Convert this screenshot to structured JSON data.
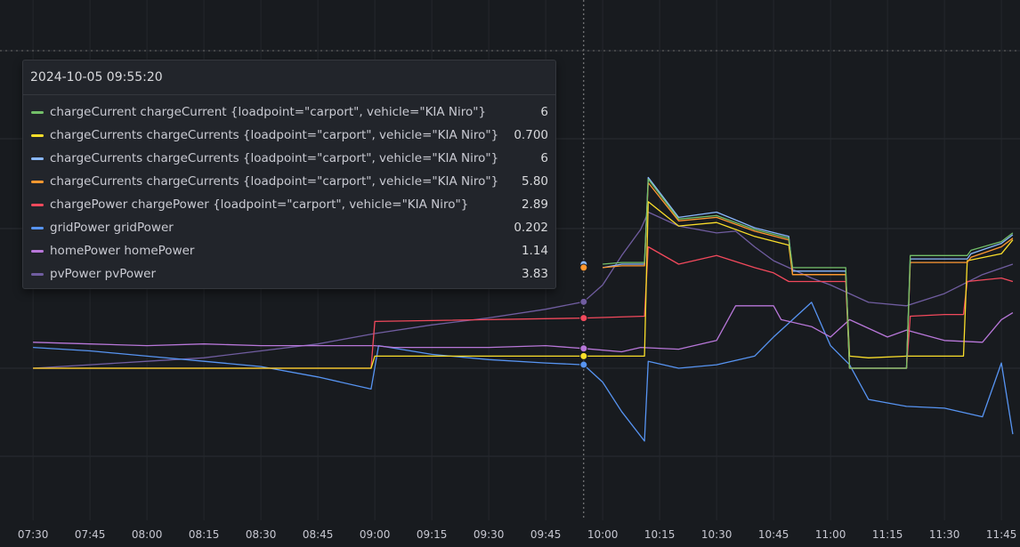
{
  "chart_data": {
    "type": "line",
    "x_range": [
      "07:30",
      "11:48"
    ],
    "x_ticks": [
      "07:30",
      "07:45",
      "08:00",
      "08:15",
      "08:30",
      "08:45",
      "09:00",
      "09:15",
      "09:30",
      "09:45",
      "10:00",
      "10:15",
      "10:30",
      "10:45",
      "11:00",
      "11:15",
      "11:30",
      "11:45"
    ],
    "hover_time": "09:55",
    "colors": {
      "chargeCurrent": "#73bf69",
      "chargeCurrents_a": "#fade2a",
      "chargeCurrents_b": "#8ab8ff",
      "chargeCurrents_c": "#ff9830",
      "chargePower": "#f2495c",
      "gridPower": "#5794f2",
      "homePower": "#b877d9",
      "pvPower": "#705da0"
    },
    "series": [
      {
        "key": "pvPower",
        "points": [
          [
            "07:30",
            0.0
          ],
          [
            "07:45",
            0.2
          ],
          [
            "08:00",
            0.4
          ],
          [
            "08:15",
            0.6
          ],
          [
            "08:30",
            1.0
          ],
          [
            "08:45",
            1.4
          ],
          [
            "09:00",
            2.0
          ],
          [
            "09:15",
            2.5
          ],
          [
            "09:30",
            2.9
          ],
          [
            "09:45",
            3.4
          ],
          [
            "09:55",
            3.83
          ],
          [
            "10:00",
            4.8
          ],
          [
            "10:05",
            6.5
          ],
          [
            "10:10",
            8.0
          ],
          [
            "10:12",
            9.0
          ],
          [
            "10:20",
            8.2
          ],
          [
            "10:30",
            7.8
          ],
          [
            "10:35",
            7.9
          ],
          [
            "10:40",
            7.0
          ],
          [
            "10:45",
            6.2
          ],
          [
            "10:55",
            5.2
          ],
          [
            "11:00",
            4.8
          ],
          [
            "11:10",
            3.8
          ],
          [
            "11:20",
            3.6
          ],
          [
            "11:30",
            4.3
          ],
          [
            "11:40",
            5.4
          ],
          [
            "11:48",
            6.0
          ]
        ]
      },
      {
        "key": "gridPower",
        "points": [
          [
            "07:30",
            1.2
          ],
          [
            "07:45",
            1.0
          ],
          [
            "08:00",
            0.7
          ],
          [
            "08:15",
            0.4
          ],
          [
            "08:30",
            0.1
          ],
          [
            "08:45",
            -0.5
          ],
          [
            "08:59",
            -1.2
          ],
          [
            "09:01",
            1.3
          ],
          [
            "09:15",
            0.8
          ],
          [
            "09:30",
            0.5
          ],
          [
            "09:45",
            0.3
          ],
          [
            "09:55",
            0.202
          ],
          [
            "10:00",
            -0.8
          ],
          [
            "10:05",
            -2.5
          ],
          [
            "10:11",
            -4.2
          ],
          [
            "10:12",
            0.4
          ],
          [
            "10:20",
            0.0
          ],
          [
            "10:30",
            0.2
          ],
          [
            "10:40",
            0.7
          ],
          [
            "10:45",
            1.8
          ],
          [
            "10:50",
            2.8
          ],
          [
            "10:55",
            3.8
          ],
          [
            "11:00",
            1.3
          ],
          [
            "11:05",
            0.2
          ],
          [
            "11:10",
            -1.8
          ],
          [
            "11:15",
            -2.0
          ],
          [
            "11:20",
            -2.2
          ],
          [
            "11:30",
            -2.3
          ],
          [
            "11:40",
            -2.8
          ],
          [
            "11:45",
            0.3
          ],
          [
            "11:48",
            -3.8
          ]
        ]
      },
      {
        "key": "homePower",
        "points": [
          [
            "07:30",
            1.5
          ],
          [
            "07:45",
            1.4
          ],
          [
            "08:00",
            1.3
          ],
          [
            "08:15",
            1.4
          ],
          [
            "08:30",
            1.3
          ],
          [
            "08:45",
            1.3
          ],
          [
            "09:00",
            1.3
          ],
          [
            "09:05",
            1.2
          ],
          [
            "09:15",
            1.2
          ],
          [
            "09:30",
            1.2
          ],
          [
            "09:45",
            1.3
          ],
          [
            "09:55",
            1.14
          ],
          [
            "10:05",
            0.95
          ],
          [
            "10:10",
            1.2
          ],
          [
            "10:20",
            1.1
          ],
          [
            "10:30",
            1.6
          ],
          [
            "10:35",
            3.6
          ],
          [
            "10:45",
            3.6
          ],
          [
            "10:47",
            2.8
          ],
          [
            "10:55",
            2.4
          ],
          [
            "11:00",
            1.8
          ],
          [
            "11:05",
            2.8
          ],
          [
            "11:15",
            1.8
          ],
          [
            "11:20",
            2.2
          ],
          [
            "11:30",
            1.6
          ],
          [
            "11:40",
            1.5
          ],
          [
            "11:45",
            2.8
          ],
          [
            "11:48",
            3.2
          ]
        ]
      },
      {
        "key": "chargePower",
        "points": [
          [
            "07:30",
            0.0
          ],
          [
            "08:59",
            0.0
          ],
          [
            "09:00",
            2.7
          ],
          [
            "09:55",
            2.89
          ],
          [
            "10:11",
            3.0
          ],
          [
            "10:12",
            7.0
          ],
          [
            "10:20",
            6.0
          ],
          [
            "10:30",
            6.5
          ],
          [
            "10:40",
            5.8
          ],
          [
            "10:45",
            5.5
          ],
          [
            "10:49",
            5.0
          ],
          [
            "10:50",
            5.0
          ],
          [
            "11:04",
            5.0
          ],
          [
            "11:05",
            0.0
          ],
          [
            "11:20",
            0.0
          ],
          [
            "11:21",
            3.0
          ],
          [
            "11:30",
            3.1
          ],
          [
            "11:35",
            3.1
          ],
          [
            "11:36",
            5.0
          ],
          [
            "11:45",
            5.2
          ],
          [
            "11:48",
            5.0
          ]
        ]
      },
      {
        "key": "chargeCurrents_a",
        "points": [
          [
            "07:30",
            0.0
          ],
          [
            "08:59",
            0.0
          ],
          [
            "09:00",
            0.7
          ],
          [
            "09:55",
            0.7
          ],
          [
            "10:11",
            0.7
          ],
          [
            "10:12",
            9.6
          ],
          [
            "10:20",
            8.2
          ],
          [
            "10:30",
            8.4
          ],
          [
            "10:40",
            7.6
          ],
          [
            "10:49",
            7.1
          ],
          [
            "10:50",
            5.4
          ],
          [
            "11:04",
            5.4
          ],
          [
            "11:05",
            0.7
          ],
          [
            "11:10",
            0.6
          ],
          [
            "11:20",
            0.7
          ],
          [
            "11:35",
            0.7
          ],
          [
            "11:36",
            6.2
          ],
          [
            "11:45",
            6.6
          ],
          [
            "11:48",
            7.4
          ]
        ]
      },
      {
        "key": "chargeCurrents_b",
        "points": [
          [
            "10:00",
            5.8
          ],
          [
            "10:05",
            6.0
          ],
          [
            "10:11",
            6.0
          ],
          [
            "10:12",
            11.0
          ],
          [
            "10:20",
            8.7
          ],
          [
            "10:30",
            9.0
          ],
          [
            "10:40",
            8.1
          ],
          [
            "10:49",
            7.6
          ],
          [
            "10:50",
            5.6
          ],
          [
            "11:04",
            5.6
          ],
          [
            "11:05",
            0.0
          ],
          [
            "11:20",
            0.0
          ],
          [
            "11:21",
            6.3
          ],
          [
            "11:36",
            6.3
          ],
          [
            "11:37",
            6.6
          ],
          [
            "11:45",
            7.2
          ],
          [
            "11:48",
            7.7
          ]
        ]
      },
      {
        "key": "chargeCurrents_c",
        "points": [
          [
            "10:00",
            5.8
          ],
          [
            "10:05",
            5.9
          ],
          [
            "10:11",
            5.9
          ],
          [
            "10:12",
            10.7
          ],
          [
            "10:20",
            8.5
          ],
          [
            "10:30",
            8.7
          ],
          [
            "10:40",
            7.9
          ],
          [
            "10:49",
            7.4
          ],
          [
            "10:50",
            5.4
          ],
          [
            "11:04",
            5.4
          ],
          [
            "11:05",
            0.0
          ],
          [
            "11:20",
            0.0
          ],
          [
            "11:21",
            6.1
          ],
          [
            "11:36",
            6.1
          ],
          [
            "11:37",
            6.4
          ],
          [
            "11:45",
            7.0
          ],
          [
            "11:48",
            7.5
          ]
        ]
      },
      {
        "key": "chargeCurrent",
        "points": [
          [
            "10:00",
            6.0
          ],
          [
            "10:05",
            6.1
          ],
          [
            "10:11",
            6.1
          ],
          [
            "10:12",
            10.9
          ],
          [
            "10:20",
            8.6
          ],
          [
            "10:30",
            8.8
          ],
          [
            "10:40",
            8.0
          ],
          [
            "10:49",
            7.5
          ],
          [
            "10:50",
            5.8
          ],
          [
            "11:04",
            5.8
          ],
          [
            "11:05",
            0.0
          ],
          [
            "11:20",
            0.0
          ],
          [
            "11:21",
            6.5
          ],
          [
            "11:36",
            6.5
          ],
          [
            "11:37",
            6.8
          ],
          [
            "11:45",
            7.3
          ],
          [
            "11:48",
            7.8
          ]
        ]
      }
    ],
    "hover_markers": [
      {
        "key": "chargeCurrents_b",
        "y": 6.0
      },
      {
        "key": "chargeCurrents_c",
        "y": 5.8
      },
      {
        "key": "pvPower",
        "y": 3.83
      },
      {
        "key": "chargePower",
        "y": 2.89
      },
      {
        "key": "homePower",
        "y": 1.14
      },
      {
        "key": "chargeCurrents_a",
        "y": 0.7
      },
      {
        "key": "gridPower",
        "y": 0.202
      }
    ]
  },
  "tooltip": {
    "time": "2024-10-05 09:55:20",
    "rows": [
      {
        "label": "chargeCurrent chargeCurrent {loadpoint=\"carport\", vehicle=\"KIA Niro\"}",
        "value": "6",
        "color": "#73bf69"
      },
      {
        "label": "chargeCurrents chargeCurrents {loadpoint=\"carport\", vehicle=\"KIA Niro\"}",
        "value": "0.700",
        "color": "#fade2a"
      },
      {
        "label": "chargeCurrents chargeCurrents {loadpoint=\"carport\", vehicle=\"KIA Niro\"}",
        "value": "6",
        "color": "#8ab8ff"
      },
      {
        "label": "chargeCurrents chargeCurrents {loadpoint=\"carport\", vehicle=\"KIA Niro\"}",
        "value": "5.80",
        "color": "#ff9830"
      },
      {
        "label": "chargePower chargePower {loadpoint=\"carport\", vehicle=\"KIA Niro\"}",
        "value": "2.89",
        "color": "#f2495c"
      },
      {
        "label": "gridPower gridPower",
        "value": "0.202",
        "color": "#5794f2"
      },
      {
        "label": "homePower homePower",
        "value": "1.14",
        "color": "#b877d9"
      },
      {
        "label": "pvPower pvPower",
        "value": "3.83",
        "color": "#705da0"
      }
    ]
  }
}
